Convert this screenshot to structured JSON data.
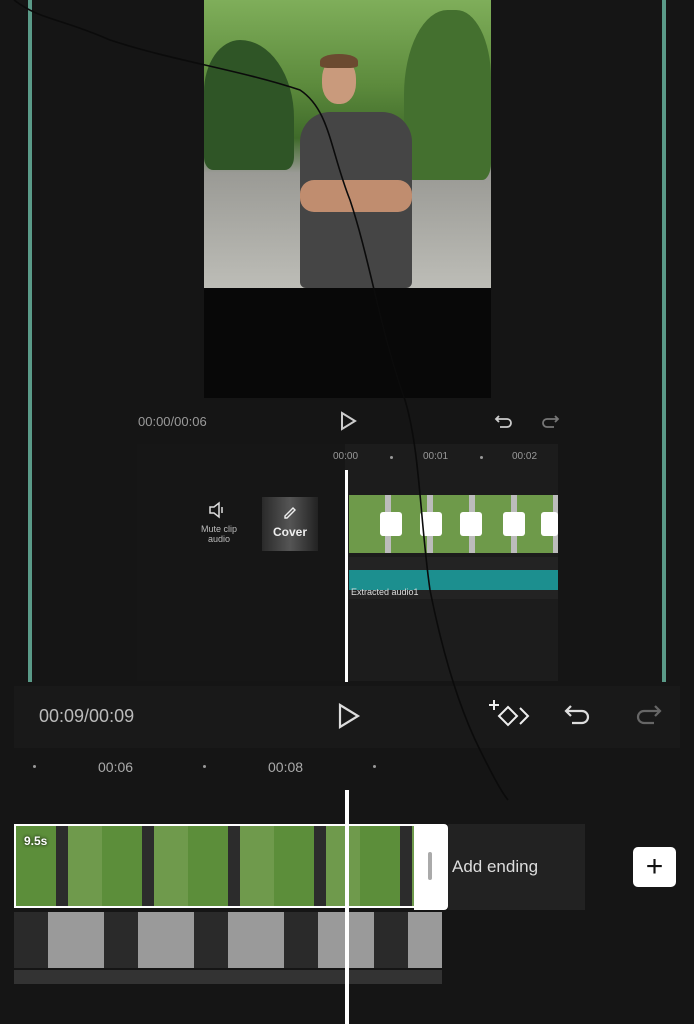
{
  "preview": {
    "timecode": "00:00/00:06",
    "tick_labels": [
      "00:00",
      "00:01",
      "00:02"
    ]
  },
  "inner_tools": {
    "mute_label": "Mute clip audio",
    "cover_label": "Cover",
    "audio_label": "Extracted audio1"
  },
  "controls": {
    "timecode": "00:09/00:09"
  },
  "timeline": {
    "ticks": [
      "00:06",
      "00:08"
    ],
    "clip_duration": "9.5s",
    "add_ending_label": "Add ending",
    "add_button_label": "+"
  },
  "colors": {
    "accent_line": "#5a9a88",
    "audio_wave": "#1c8f8f",
    "background": "#151515"
  }
}
